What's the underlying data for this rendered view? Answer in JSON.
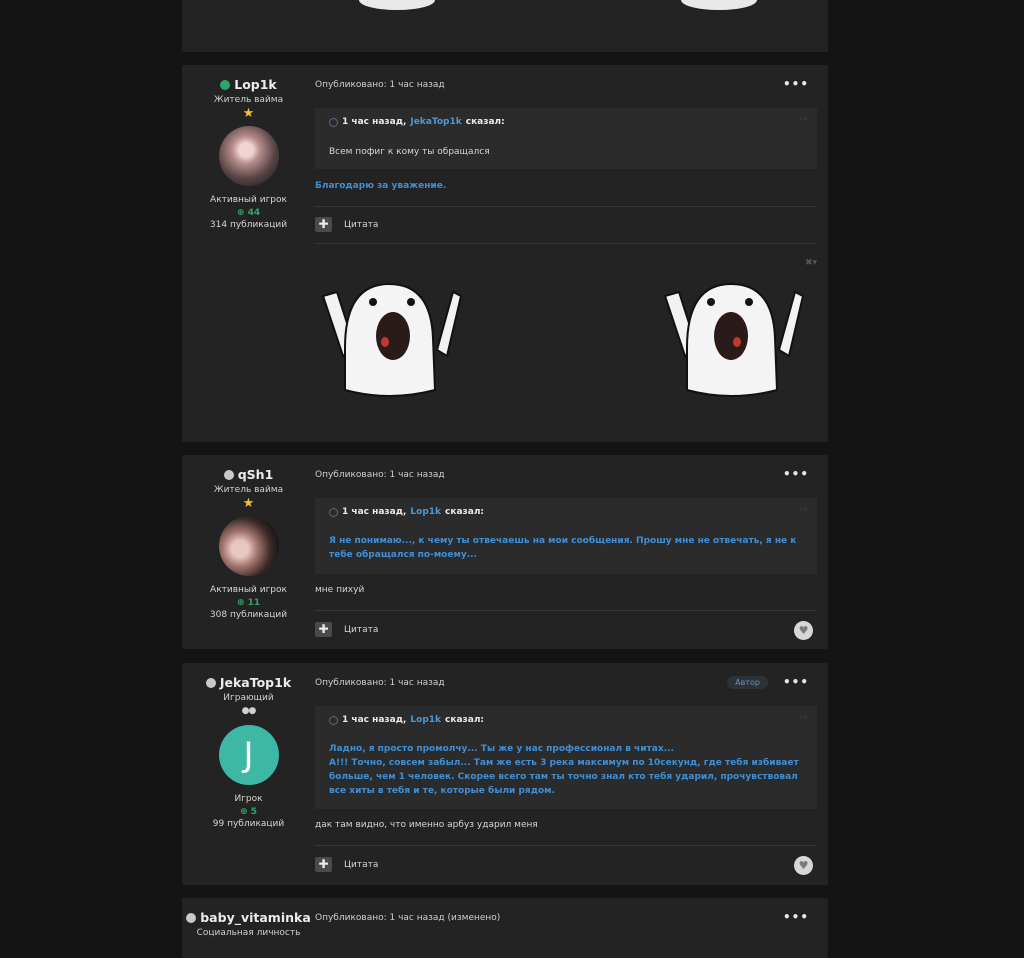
{
  "colors": {
    "page_bg": "#141414",
    "card_bg": "#232323",
    "quote_bg": "#2b2b2b",
    "link_blue": "#3f8fd4",
    "online_green": "#2ea66b",
    "avatar_teal": "#3db8a5"
  },
  "icons": {
    "more": "•••",
    "plus": "✚",
    "share": "↪",
    "heart": "♥",
    "close": "✖▾",
    "star": "★",
    "rep": "⊕"
  },
  "posts": [
    {
      "author": {
        "name": "Lop1k",
        "status": "online",
        "title": "Житель вайма",
        "group": "Активный игрок",
        "rep": "44",
        "posts": "314 публикаций"
      },
      "meta": "Опубликовано: 1 час назад",
      "quote": {
        "time": "1 час назад,",
        "user": "JekaTop1k",
        "said": "сказал:",
        "text": "Всем пофиг к кому ты обращался"
      },
      "thanks": "Благодарю за уважение.",
      "cite": "Цитата"
    },
    {
      "author": {
        "name": "qSh1",
        "status": "offline",
        "title": "Житель вайма",
        "group": "Активный игрок",
        "rep": "11",
        "posts": "308 публикаций"
      },
      "meta": "Опубликовано: 1 час назад",
      "quote": {
        "time": "1 час назад,",
        "user": "Lop1k",
        "said": "сказал:",
        "text": "Я не понимаю..., к чему ты отвечаешь на мои сообщения. Прошу мне не отвечать, я не к тебе обращался по-моему..."
      },
      "text": "мне пихуй",
      "cite": "Цитата"
    },
    {
      "author": {
        "name": "JekaTop1k",
        "status": "offline",
        "title": "Играющий",
        "pips": "●●",
        "avatar_letter": "J",
        "group": "Игрок",
        "rep": "5",
        "posts": "99 публикаций"
      },
      "meta": "Опубликовано: 1 час назад",
      "badge": "Автор",
      "quote": {
        "time": "1 час назад,",
        "user": "Lop1k",
        "said": "сказал:",
        "line1": "Ладно, я просто промолчу... Ты же у нас профессионал в читах...",
        "line2": "А!!! Точно, совсем забыл... Там же есть 3 река максимум по 10секунд, где тебя избивает больше, чем 1 человек. Скорее всего там ты точно знал кто тебя ударил, прочувствовал все хиты в тебя и те, которые были рядом."
      },
      "text": "дак там видно, что именно арбуз ударил меня",
      "cite": "Цитата"
    },
    {
      "author": {
        "name": "baby_vitaminka",
        "status": "offline",
        "title": "Социальная личность"
      },
      "meta": "Опубликовано: 1 час назад (изменено)"
    }
  ]
}
